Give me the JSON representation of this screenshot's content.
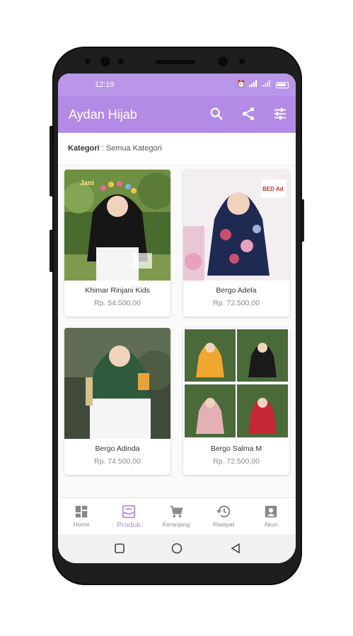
{
  "status_bar": {
    "time": "12:19",
    "icons": [
      "alarm-icon",
      "signal-icon",
      "wifi-icon",
      "battery-icon"
    ]
  },
  "app_bar": {
    "title": "Aydan Hijab",
    "actions": [
      {
        "name": "search-icon"
      },
      {
        "name": "share-icon"
      },
      {
        "name": "filter-icon"
      }
    ]
  },
  "category": {
    "label": "Kategori",
    "separator": " : ",
    "value": "Semua Kategori"
  },
  "products": [
    {
      "name": "Khimar Rinjani Kids",
      "price": "Rp. 54.500,00",
      "image_text": "Jani"
    },
    {
      "name": "Bergo Adela",
      "price": "Rp. 72.500,00",
      "image_text": "BED Ad"
    },
    {
      "name": "Bergo Adinda",
      "price": "Rp. 74.500,00"
    },
    {
      "name": "Bergo Salma M",
      "price": "Rp. 72.500,00"
    }
  ],
  "bottom_nav": {
    "items": [
      {
        "label": "Home",
        "icon": "dashboard-icon",
        "active": false
      },
      {
        "label": "Produk",
        "icon": "inbox-icon",
        "active": true
      },
      {
        "label": "Keranjang",
        "icon": "cart-icon",
        "active": false
      },
      {
        "label": "Riwayat",
        "icon": "history-icon",
        "active": false
      },
      {
        "label": "Akun",
        "icon": "account-icon",
        "active": false
      }
    ]
  },
  "colors": {
    "accent": "#b38be6",
    "status_bar": "#b896e8",
    "text_muted": "#8a8a8a"
  }
}
